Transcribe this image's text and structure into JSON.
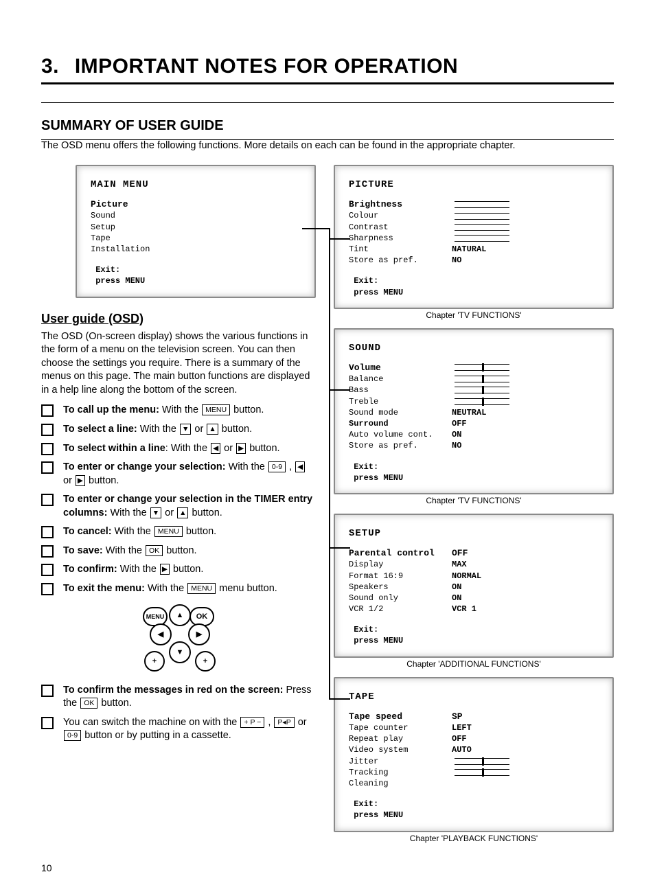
{
  "chapter": {
    "num": "3.",
    "title": "IMPORTANT NOTES FOR OPERATION"
  },
  "section": "SUMMARY OF USER GUIDE",
  "intro": "The OSD menu offers the following functions. More details on each can be found in the appropriate chapter.",
  "mainMenu": {
    "title": "MAIN MENU",
    "hl": "Picture",
    "items": [
      "Sound",
      "Setup",
      "Tape",
      "Installation"
    ],
    "exit": " Exit:\n press MENU"
  },
  "picture": {
    "title": "PICTURE",
    "hl": "Brightness",
    "rows": [
      {
        "lab": "Colour",
        "bar": true
      },
      {
        "lab": "Contrast",
        "bar": true
      },
      {
        "lab": "Sharpness",
        "bar": true
      },
      {
        "lab": "Tint",
        "val": "NATURAL"
      },
      {
        "lab": "Store as pref.",
        "val": "NO"
      }
    ],
    "exit": " Exit:\n press MENU",
    "caption": "Chapter 'TV FUNCTIONS'"
  },
  "sound": {
    "title": "SOUND",
    "hl": "Volume",
    "rows": [
      {
        "lab": "Balance",
        "bar": true,
        "tick": true
      },
      {
        "lab": "Bass",
        "bar": true,
        "tick": true
      },
      {
        "lab": "Treble",
        "bar": true,
        "tick": true
      },
      {
        "lab": "Sound mode",
        "val": "NEUTRAL"
      },
      {
        "lab": "Surround",
        "val": "OFF",
        "bold": true
      },
      {
        "lab": "Auto volume cont.",
        "val": "ON"
      },
      {
        "lab": "Store as pref.",
        "val": "NO"
      }
    ],
    "exit": " Exit:\n press MENU",
    "caption": "Chapter 'TV FUNCTIONS'"
  },
  "setup": {
    "title": "SETUP",
    "hl": "Parental control",
    "hlval": "OFF",
    "rows": [
      {
        "lab": "Display",
        "val": "MAX"
      },
      {
        "lab": "Format 16:9",
        "val": "NORMAL"
      },
      {
        "lab": "Speakers",
        "val": "ON"
      },
      {
        "lab": "Sound only",
        "val": "ON"
      },
      {
        "lab": "VCR 1/2",
        "val": "VCR 1"
      }
    ],
    "exit": " Exit:\n press MENU",
    "caption": "Chapter 'ADDITIONAL FUNCTIONS'"
  },
  "tape": {
    "title": "TAPE",
    "hl": "Tape speed",
    "hlval": "SP",
    "rows": [
      {
        "lab": "Tape counter",
        "val": "LEFT"
      },
      {
        "lab": "Repeat play",
        "val": "OFF"
      },
      {
        "lab": "Video system",
        "val": "AUTO"
      },
      {
        "lab": "Jitter",
        "bar": true,
        "tick": true
      },
      {
        "lab": "Tracking",
        "bar": true,
        "tick": true
      },
      {
        "lab": "Cleaning"
      }
    ],
    "exit": " Exit:\n press MENU",
    "caption": "Chapter 'PLAYBACK FUNCTIONS'"
  },
  "userGuide": {
    "title": "User guide (OSD)",
    "para": "The OSD (On-screen display) shows the various functions in the form of a menu on the television screen. You can then choose the settings you require. There is a summary of the menus on this page. The main button functions are displayed in a help line along the bottom of the screen.",
    "steps": {
      "call": {
        "b": "To call up the menu:",
        "t": " With the ",
        "k": "MENU",
        "t2": " button."
      },
      "selLine": {
        "b": "To select a line:",
        "t": " With the ",
        "t2": " or ",
        "t3": " button."
      },
      "selWithin": {
        "b": "To select within a line",
        "t": ": With the ",
        "t2": " or ",
        "t3": " button."
      },
      "enter": {
        "b": "To enter or change your selection:",
        "t": " With the ",
        "k": "0-9",
        "t2": " , ",
        "t3": " or ",
        "t4": " button."
      },
      "timer": {
        "b": "To enter or change your selection in the TIMER entry columns:",
        "t": " With the ",
        "t2": " or ",
        "t3": " button."
      },
      "cancel": {
        "b": "To cancel:",
        "t": " With the ",
        "k": "MENU",
        "t2": " button."
      },
      "save": {
        "b": "To save:",
        "t": " With the ",
        "k": "OK",
        "t2": " button."
      },
      "confirm": {
        "b": "To confirm:",
        "t": " With the ",
        "t2": " button."
      },
      "exit": {
        "b": "To exit the menu:",
        "t": " With the ",
        "k": "MENU",
        "t2": " menu button."
      },
      "confirmRed": {
        "b": "To confirm the messages in red on the screen:",
        "t": " Press the ",
        "k": "OK",
        "t2": " button."
      },
      "switchOn": {
        "t1": "You can switch the machine on with the ",
        "k1": "+ P −",
        "t2": " , ",
        "k2": "P◂P",
        "t3": " or ",
        "k3": "0-9",
        "t4": " button or by putting in a cassette."
      }
    }
  },
  "remote": {
    "menu": "MENU",
    "ok": "OK",
    "plus": "+",
    "plus2": "+"
  },
  "pageNum": "10"
}
